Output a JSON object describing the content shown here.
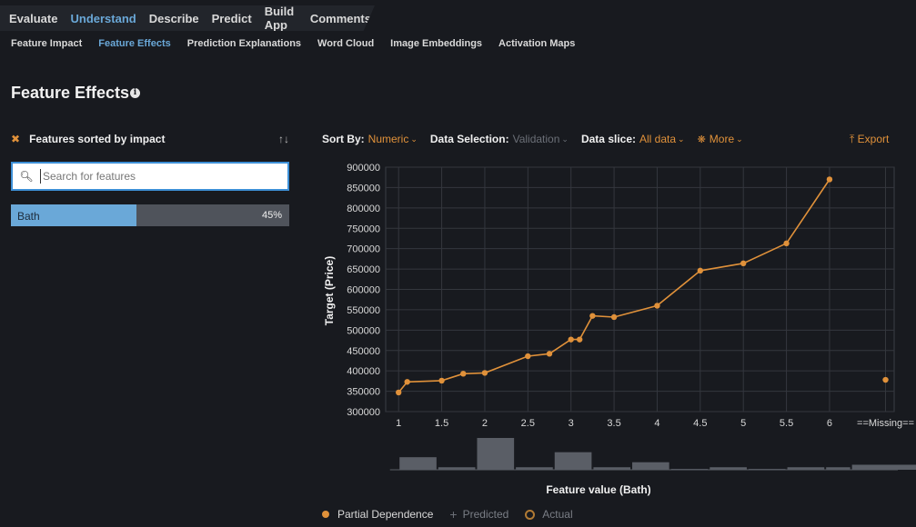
{
  "top_tabs": [
    {
      "label": "Evaluate"
    },
    {
      "label": "Understand",
      "active": true
    },
    {
      "label": "Describe"
    },
    {
      "label": "Predict"
    },
    {
      "label": "Build App"
    },
    {
      "label": "Comments"
    }
  ],
  "sub_tabs": [
    {
      "label": "Feature Impact"
    },
    {
      "label": "Feature Effects",
      "active": true
    },
    {
      "label": "Prediction Explanations"
    },
    {
      "label": "Word Cloud"
    },
    {
      "label": "Image Embeddings"
    },
    {
      "label": "Activation Maps"
    }
  ],
  "page_title": "Feature Effects",
  "left_panel": {
    "header": "Features sorted by impact",
    "search_placeholder": "Search for features",
    "features": [
      {
        "name": "Bath",
        "impact_label": "45%",
        "impact": 0.45
      }
    ]
  },
  "controls": {
    "sort_label": "Sort By:",
    "sort_value": "Numeric",
    "data_selection_label": "Data Selection:",
    "data_selection_value": "Validation",
    "data_slice_label": "Data slice:",
    "data_slice_value": "All data",
    "more_label": "More",
    "export_label": "Export"
  },
  "colors": {
    "accent": "#e0913a",
    "active_tab": "#6aa8d8",
    "histogram": "#5a5e66"
  },
  "chart_data": {
    "type": "line",
    "ylabel": "Target (Price)",
    "xlabel": "Feature value (Bath)",
    "ylim": [
      300000,
      900000
    ],
    "y_ticks": [
      300000,
      350000,
      400000,
      450000,
      500000,
      550000,
      600000,
      650000,
      700000,
      750000,
      800000,
      850000,
      900000
    ],
    "x_ticks": [
      "1",
      "1.5",
      "2",
      "2.5",
      "3",
      "3.5",
      "4",
      "4.5",
      "5",
      "5.5",
      "6",
      "==Missing=="
    ],
    "xlim": [
      0.85,
      6.75
    ],
    "grid": true,
    "series": [
      {
        "name": "Partial Dependence",
        "x": [
          1,
          1.1,
          1.5,
          1.75,
          2,
          2.5,
          2.75,
          3,
          3.1,
          3.25,
          3.5,
          4,
          4.5,
          5,
          5.5,
          6
        ],
        "y": [
          347000,
          373000,
          376000,
          393000,
          395000,
          436000,
          442000,
          477000,
          477000,
          535000,
          532000,
          560000,
          646000,
          664000,
          713000,
          870000
        ]
      }
    ],
    "missing_value": 378000,
    "histogram": {
      "bars": [
        {
          "x0": 1.0,
          "x1": 1.45,
          "count": 15
        },
        {
          "x0": 1.45,
          "x1": 1.9,
          "count": 3
        },
        {
          "x0": 1.9,
          "x1": 2.35,
          "count": 38
        },
        {
          "x0": 2.35,
          "x1": 2.8,
          "count": 3
        },
        {
          "x0": 2.8,
          "x1": 3.25,
          "count": 21
        },
        {
          "x0": 3.25,
          "x1": 3.7,
          "count": 3
        },
        {
          "x0": 3.7,
          "x1": 4.15,
          "count": 9
        },
        {
          "x0": 4.15,
          "x1": 4.6,
          "count": 1
        },
        {
          "x0": 4.6,
          "x1": 5.05,
          "count": 3
        },
        {
          "x0": 5.05,
          "x1": 5.5,
          "count": 1
        },
        {
          "x0": 5.5,
          "x1": 5.95,
          "count": 3
        },
        {
          "x0": 5.95,
          "x1": 6.25,
          "count": 3
        },
        {
          "x0": 6.25,
          "x1": 7.3,
          "count": 6
        }
      ],
      "max": 38
    },
    "legend": [
      {
        "label": "Partial Dependence",
        "marker": "dot"
      },
      {
        "label": "Predicted",
        "marker": "plus"
      },
      {
        "label": "Actual",
        "marker": "ring"
      }
    ]
  }
}
